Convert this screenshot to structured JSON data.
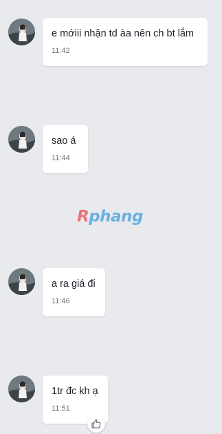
{
  "messages": [
    {
      "text": "e mớiii nhận td àa nên ch bt lắm",
      "time": "11:42"
    },
    {
      "text": "sao á",
      "time": "11:44"
    },
    {
      "text": "a ra giá đi",
      "time": "11:46"
    },
    {
      "text": "1tr đc kh ạ",
      "time": "11:51"
    }
  ],
  "watermark": {
    "part1": "R",
    "part2": "phang"
  },
  "icons": {
    "reaction": "thumbs-up-icon",
    "avatar": "contact-avatar"
  },
  "colors": {
    "background": "#e9eaee",
    "bubble": "#ffffff",
    "text": "#1d2129",
    "time": "#6f757d"
  }
}
